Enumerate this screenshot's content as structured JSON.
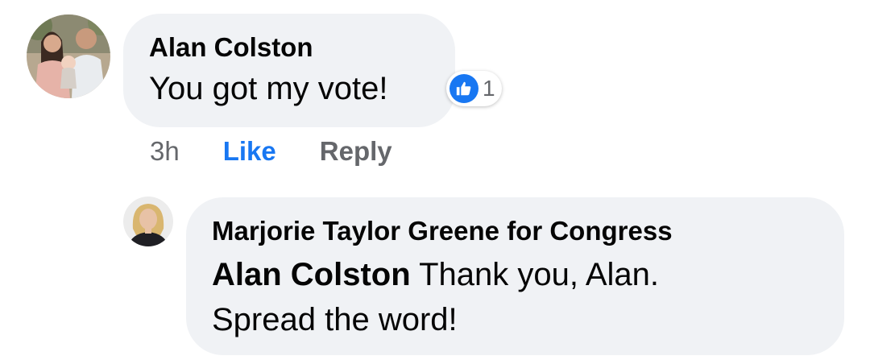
{
  "comment": {
    "author": "Alan Colston",
    "text": "You got my vote!",
    "reaction": {
      "icon": "thumbs-up-icon",
      "count": "1",
      "color": "#1877f2"
    },
    "actions": {
      "time": "3h",
      "like_label": "Like",
      "reply_label": "Reply"
    }
  },
  "reply": {
    "author": "Marjorie Taylor Greene for Congress",
    "mention": "Alan Colston",
    "text_line1": " Thank you, Alan.",
    "text_line2": "Spread the word!"
  },
  "colors": {
    "bubble_bg": "#f0f2f5",
    "link_blue": "#1877f2",
    "muted_text": "#65676b",
    "primary_text": "#050505"
  }
}
